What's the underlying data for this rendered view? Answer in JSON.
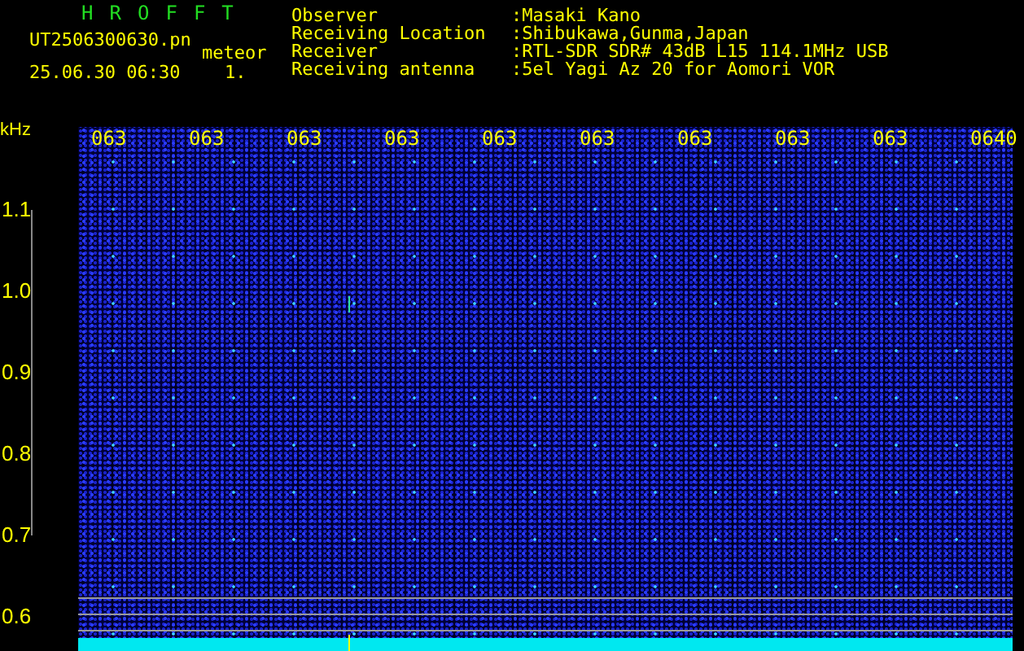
{
  "header": {
    "title_letters": [
      "H",
      "R",
      "O",
      "F",
      "F",
      "T"
    ],
    "filename": "UT2506300630.pn",
    "event_type": "meteor",
    "datetime": "25.06.30 06:30",
    "count": "1.",
    "info": [
      {
        "label": "Observer",
        "value": ":Masaki Kano"
      },
      {
        "label": "Receiving Location",
        "value": ":Shibukawa,Gunma,Japan"
      },
      {
        "label": "Receiver",
        "value": ":RTL-SDR SDR# 43dB L15 114.1MHz USB"
      },
      {
        "label": "Receiving antenna",
        "value": ":5el Yagi Az 20 for Aomori VOR"
      }
    ]
  },
  "spectrogram": {
    "unit": "kHz",
    "time_labels": [
      "063",
      "063",
      "063",
      "063",
      "063",
      "063",
      "063",
      "063",
      "063",
      "0640"
    ],
    "frequency_labels": [
      "1.1",
      "1.0",
      "0.9",
      "0.8",
      "0.7",
      "0.6"
    ]
  }
}
